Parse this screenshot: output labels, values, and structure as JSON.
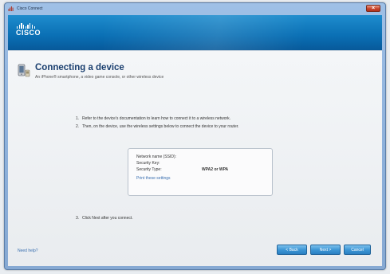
{
  "window": {
    "title": "Cisco Connect",
    "close_glyph": "×"
  },
  "header": {
    "logo_text": "CISCO"
  },
  "page": {
    "title": "Connecting a device",
    "subtitle": "An iPhone® smartphone, a video game console, or other wireless device"
  },
  "steps": [
    {
      "num": "1.",
      "text": "Refer to the device's documentation to learn how to connect it to a wireless network."
    },
    {
      "num": "2.",
      "text": "Then, on the device, use the wireless settings below to connect the device to your router."
    },
    {
      "num": "3.",
      "text": "Click Next after you connect."
    }
  ],
  "settings": {
    "network_name_label": "Network name (SSID):",
    "network_name_value": "",
    "security_key_label": "Security Key:",
    "security_key_value": "",
    "security_type_label": "Security Type:",
    "security_type_value": "WPA2 or WPA",
    "print_link": "Print these settings"
  },
  "footer": {
    "help_link": "Need help?",
    "back_label": "< Back",
    "next_label": "Next >",
    "cancel_label": "Cancel"
  },
  "colors": {
    "header_blue": "#0a6fb4",
    "button_blue": "#3e97d6",
    "title_blue": "#1a3f6f",
    "link_blue": "#3a6fb0",
    "close_red": "#c8442a"
  }
}
